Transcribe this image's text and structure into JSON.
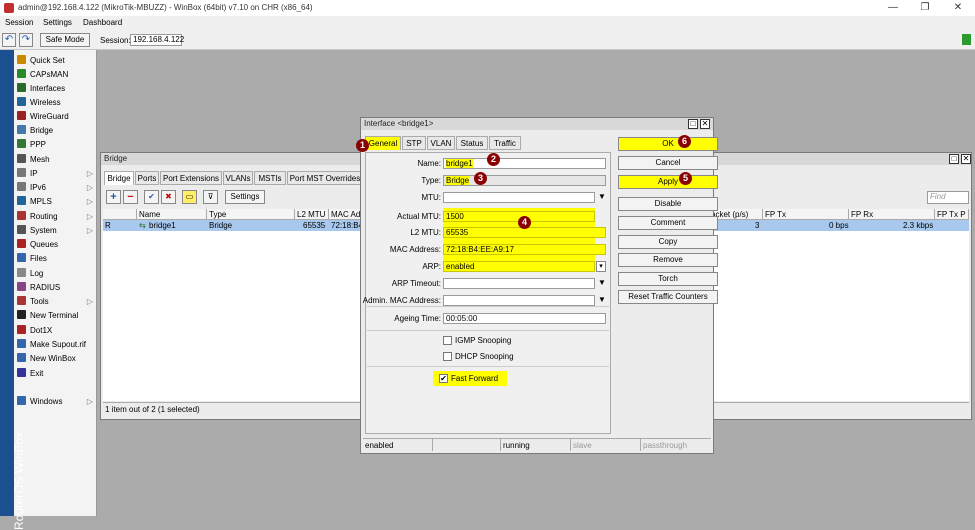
{
  "app": {
    "title": "admin@192.168.4.122 (MikroTik-MBUZZ) - WinBox (64bit) v7.10 on CHR (x86_64)",
    "brand_vertical": "RouterOS WinBox"
  },
  "window_controls": {
    "minimize": "—",
    "maximize": "❐",
    "close": "✕"
  },
  "menu": [
    "Session",
    "Settings",
    "Dashboard"
  ],
  "toolbar": {
    "undo": "↶",
    "redo": "↷",
    "safe_mode": "Safe Mode",
    "session_label": "Session:",
    "session_value": "192.168.4.122"
  },
  "sidebar": [
    {
      "label": "Quick Set",
      "icon": "quickset-icon",
      "color": "#cc8800",
      "arrow": ""
    },
    {
      "label": "CAPsMAN",
      "icon": "capsman-icon",
      "color": "#2a8a2a",
      "arrow": ""
    },
    {
      "label": "Interfaces",
      "icon": "interfaces-icon",
      "color": "#2a6a2a",
      "arrow": ""
    },
    {
      "label": "Wireless",
      "icon": "wireless-icon",
      "color": "#226699",
      "arrow": ""
    },
    {
      "label": "WireGuard",
      "icon": "wireguard-icon",
      "color": "#992222",
      "arrow": ""
    },
    {
      "label": "Bridge",
      "icon": "bridge-icon",
      "color": "#4477aa",
      "arrow": ""
    },
    {
      "label": "PPP",
      "icon": "ppp-icon",
      "color": "#337733",
      "arrow": ""
    },
    {
      "label": "Mesh",
      "icon": "mesh-icon",
      "color": "#555555",
      "arrow": ""
    },
    {
      "label": "IP",
      "icon": "ip-icon",
      "color": "#777777",
      "arrow": "▷"
    },
    {
      "label": "IPv6",
      "icon": "ipv6-icon",
      "color": "#777777",
      "arrow": "▷"
    },
    {
      "label": "MPLS",
      "icon": "mpls-icon",
      "color": "#226699",
      "arrow": "▷"
    },
    {
      "label": "Routing",
      "icon": "routing-icon",
      "color": "#aa3333",
      "arrow": "▷"
    },
    {
      "label": "System",
      "icon": "system-icon",
      "color": "#555555",
      "arrow": "▷"
    },
    {
      "label": "Queues",
      "icon": "queues-icon",
      "color": "#aa2222",
      "arrow": ""
    },
    {
      "label": "Files",
      "icon": "files-icon",
      "color": "#3366aa",
      "arrow": ""
    },
    {
      "label": "Log",
      "icon": "log-icon",
      "color": "#888888",
      "arrow": ""
    },
    {
      "label": "RADIUS",
      "icon": "radius-icon",
      "color": "#884488",
      "arrow": ""
    },
    {
      "label": "Tools",
      "icon": "tools-icon",
      "color": "#aa3333",
      "arrow": "▷"
    },
    {
      "label": "New Terminal",
      "icon": "terminal-icon",
      "color": "#222222",
      "arrow": ""
    },
    {
      "label": "Dot1X",
      "icon": "dot1x-icon",
      "color": "#aa2222",
      "arrow": ""
    },
    {
      "label": "Make Supout.rif",
      "icon": "supout-icon",
      "color": "#3366aa",
      "arrow": ""
    },
    {
      "label": "New WinBox",
      "icon": "winbox-icon",
      "color": "#3366aa",
      "arrow": ""
    },
    {
      "label": "Exit",
      "icon": "exit-icon",
      "color": "#333399",
      "arrow": ""
    },
    {
      "label": "Windows",
      "icon": "windows-icon",
      "color": "#3366aa",
      "arrow": "▷"
    }
  ],
  "bridge_window": {
    "title": "Bridge",
    "tabs": [
      "Bridge",
      "Ports",
      "Port Extensions",
      "VLANs",
      "MSTIs",
      "Port MST Overrides"
    ],
    "buttons": {
      "add": "+",
      "remove": "−",
      "enable": "✔",
      "disable": "✖",
      "comment": "▭",
      "filter": "⊽",
      "settings": "Settings"
    },
    "find_placeholder": "Find",
    "columns": [
      "",
      "Name",
      "Type",
      "L2 MTU",
      "MAC Add",
      "acket (p/s)",
      "FP Tx",
      "FP Rx",
      "FP Tx P"
    ],
    "row": {
      "flag": "R",
      "name": "bridge1",
      "type": "Bridge",
      "l2mtu": "65535",
      "mac": "72:18:B4",
      "packets": "3",
      "fptx": "0 bps",
      "fprx": "2.3 kbps"
    },
    "status": "1 item out of 2 (1 selected)"
  },
  "dialog": {
    "title": "Interface <bridge1>",
    "tabs": [
      "General",
      "STP",
      "VLAN",
      "Status",
      "Traffic"
    ],
    "fields": {
      "name": {
        "label": "Name:",
        "value": "bridge1"
      },
      "type": {
        "label": "Type:",
        "value": "Bridge"
      },
      "mtu": {
        "label": "MTU:",
        "value": ""
      },
      "actual_mtu": {
        "label": "Actual MTU:",
        "value": "1500"
      },
      "l2_mtu": {
        "label": "L2 MTU:",
        "value": "65535"
      },
      "mac": {
        "label": "MAC Address:",
        "value": "72:18:B4:EE:A9:17"
      },
      "arp": {
        "label": "ARP:",
        "value": "enabled"
      },
      "arp_timeout": {
        "label": "ARP Timeout:",
        "value": ""
      },
      "admin_mac": {
        "label": "Admin. MAC Address:",
        "value": ""
      },
      "ageing": {
        "label": "Ageing Time:",
        "value": "00:05:00"
      }
    },
    "checks": {
      "igmp": "IGMP Snooping",
      "dhcp": "DHCP Snooping",
      "fast_forward": "Fast Forward"
    },
    "buttons": {
      "ok": "OK",
      "cancel": "Cancel",
      "apply": "Apply",
      "disable": "Disable",
      "comment": "Comment",
      "copy": "Copy",
      "remove": "Remove",
      "torch": "Torch",
      "reset": "Reset Traffic Counters"
    },
    "status": [
      "enabled",
      "",
      "running",
      "slave",
      "passthrough"
    ]
  },
  "badges": [
    "1",
    "2",
    "3",
    "4",
    "5",
    "6"
  ],
  "colors": {
    "highlight": "#ffff00",
    "badge": "#8b0000",
    "selection": "#a8c8ee",
    "brand_bar": "#1c4f8f"
  }
}
